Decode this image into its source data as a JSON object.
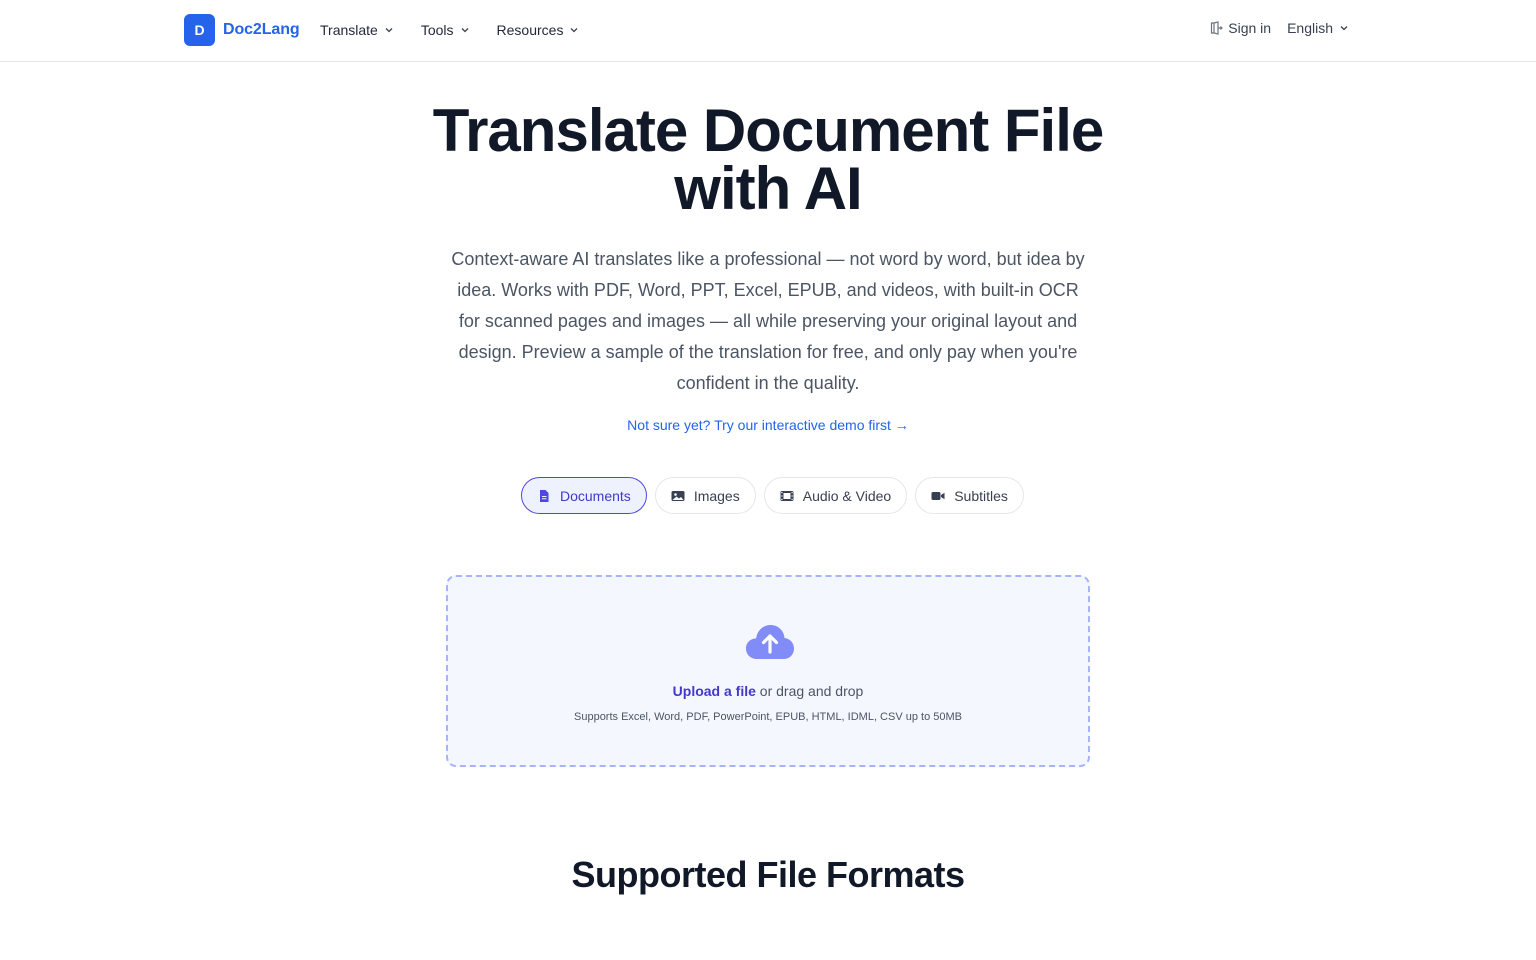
{
  "header": {
    "logo_letter": "D",
    "logo_text": "Doc2Lang",
    "nav": [
      {
        "label": "Translate"
      },
      {
        "label": "Tools"
      },
      {
        "label": "Resources"
      }
    ],
    "sign_in": "Sign in",
    "language": "English"
  },
  "hero": {
    "title_line1": "Translate Document File",
    "title_line2": "with AI",
    "description": "Context-aware AI translates like a professional — not word by word, but idea by idea. Works with PDF, Word, PPT, Excel, EPUB, and videos, with built-in OCR for scanned pages and images — all while preserving your original layout and design. Preview a sample of the translation for free, and only pay when you're confident in the quality.",
    "demo_link": "Not sure yet? Try our interactive demo first →"
  },
  "tabs": [
    {
      "label": "Documents",
      "icon": "document-icon",
      "active": true
    },
    {
      "label": "Images",
      "icon": "image-icon",
      "active": false
    },
    {
      "label": "Audio & Video",
      "icon": "film-icon",
      "active": false
    },
    {
      "label": "Subtitles",
      "icon": "video-camera-icon",
      "active": false
    }
  ],
  "upload": {
    "icon": "cloud-upload-icon",
    "link_text": "Upload a file",
    "rest_text": " or drag and drop",
    "note": "Supports Excel, Word, PDF, PowerPoint, EPUB, HTML, IDML, CSV up to 50MB"
  },
  "sections": {
    "formats_title": "Supported File Formats"
  },
  "colors": {
    "brand": "#2563eb",
    "active_tab": "#4f46e5",
    "upload_bg": "#f5f7ff",
    "upload_border": "#a5b4fc",
    "cloud_icon": "#818cf8"
  }
}
